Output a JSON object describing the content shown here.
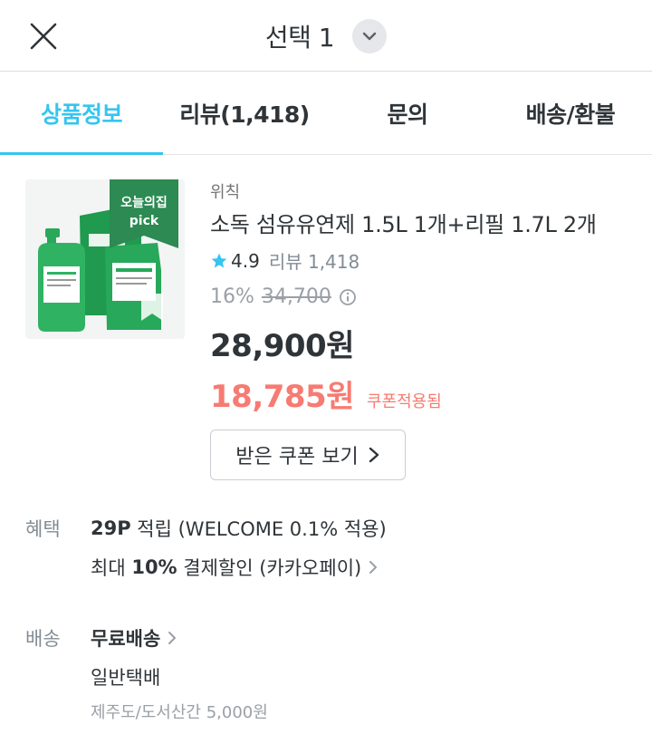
{
  "header": {
    "title": "선택 1",
    "close_icon": "close-icon",
    "dropdown_icon": "chevron-down-icon"
  },
  "tabs": [
    {
      "label": "상품정보",
      "active": true
    },
    {
      "label": "리뷰(1,418)",
      "active": false
    },
    {
      "label": "문의",
      "active": false
    },
    {
      "label": "배송/환불",
      "active": false
    }
  ],
  "product": {
    "badge_line1": "오늘의집",
    "badge_line2": "pick",
    "image_label": "WECHIK",
    "brand": "위칙",
    "name": "소독 섬유유연제 1.5L 1개+리필 1.7L 2개",
    "rating": "4.9",
    "review_label": "리뷰 1,418",
    "discount_rate": "16%",
    "original_price": "34,700",
    "price": "28,900원",
    "coupon_price": "18,785원",
    "coupon_applied_label": "쿠폰적용됨",
    "coupon_button_label": "받은 쿠폰 보기"
  },
  "benefit": {
    "label": "혜택",
    "points_strong": "29P",
    "points_text": " 적립 (WELCOME 0.1% 적용)",
    "discount_prefix": "최대 ",
    "discount_strong": "10%",
    "discount_text": " 결제할인 (카카오페이)"
  },
  "shipping": {
    "label": "배송",
    "free_label": "무료배송",
    "method": "일반택배",
    "extra": "제주도/도서산간 5,000원"
  },
  "colors": {
    "accent": "#35c5f0",
    "coupon": "#f77b72",
    "star": "#35c5f0",
    "badge": "#2c8a52"
  }
}
